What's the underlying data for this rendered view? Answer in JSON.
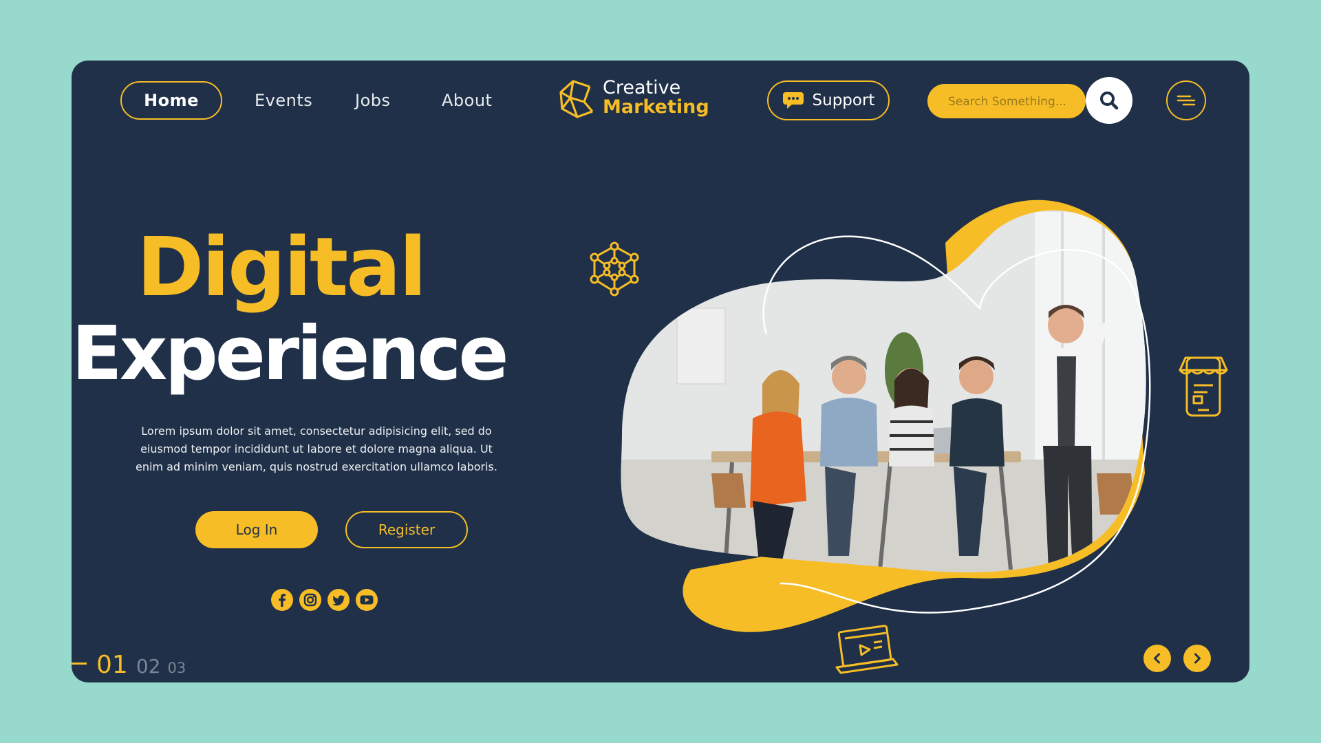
{
  "nav": {
    "home": "Home",
    "events": "Events",
    "jobs": "Jobs",
    "about": "About"
  },
  "logo": {
    "line1": "Creative",
    "line2": "Marketing"
  },
  "support": {
    "label": "Support"
  },
  "search": {
    "placeholder": "Search Something..."
  },
  "hero": {
    "title_line1": "Digital",
    "title_line2": "Experience",
    "body": "Lorem ipsum dolor sit amet, consectetur adipisicing elit, sed do eiusmod tempor incididunt ut labore et dolore magna aliqua. Ut enim ad minim veniam, quis nostrud exercitation ullamco laboris.",
    "login_label": "Log In",
    "register_label": "Register"
  },
  "socials": [
    "facebook-icon",
    "instagram-icon",
    "twitter-icon",
    "youtube-icon"
  ],
  "pager": {
    "current": "01",
    "second": "02",
    "third": "03"
  },
  "colors": {
    "page_bg": "#97d9cd",
    "card_bg": "#1f3048",
    "accent": "#f7bd26",
    "text": "#ffffff"
  }
}
